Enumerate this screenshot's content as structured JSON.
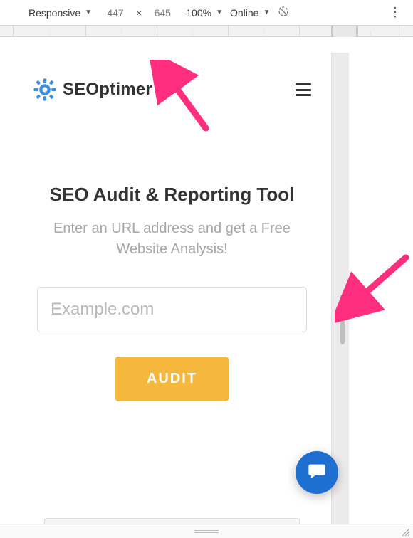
{
  "toolbar": {
    "device_label": "Responsive",
    "width": "447",
    "height": "645",
    "zoom": "100%",
    "throttle": "Online"
  },
  "logo": {
    "text": "SEOptimer"
  },
  "hero": {
    "title": "SEO Audit & Reporting Tool",
    "subtitle": "Enter an URL address and get a Free Website Analysis!"
  },
  "form": {
    "placeholder": "Example.com",
    "button": "AUDIT"
  },
  "mini_browser": {
    "dot_colors": [
      "#f26b5e",
      "#f8c94e",
      "#67c266"
    ]
  },
  "colors": {
    "accent_blue": "#3d8ee0",
    "button": "#f5b83d",
    "chat": "#1f6fd1",
    "annotation": "#ff2e7e"
  }
}
